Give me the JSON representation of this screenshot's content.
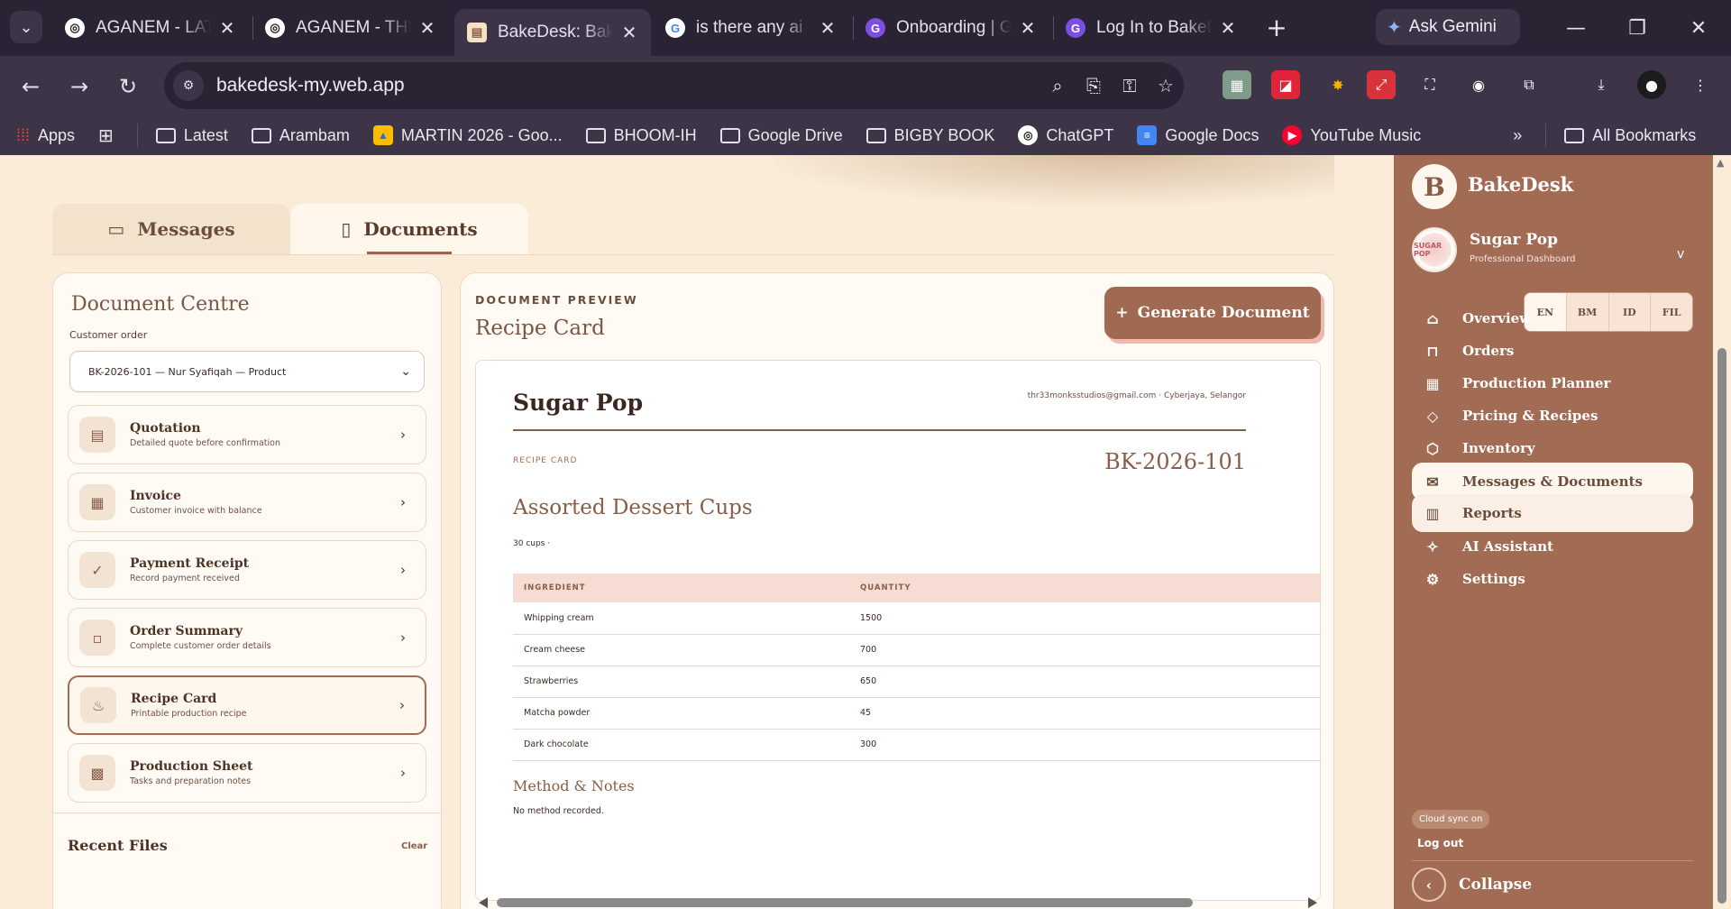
{
  "browser": {
    "tabs": [
      {
        "title": "AGANEM - LATEST",
        "icon": "chatgpt-icon"
      },
      {
        "title": "AGANEM - THE",
        "icon": "chatgpt-icon"
      },
      {
        "title": "BakeDesk: Bakery",
        "icon": "bakedesk-icon"
      },
      {
        "title": "is there any ai",
        "icon": "google-icon"
      },
      {
        "title": "Onboarding | G",
        "icon": "g-app-icon"
      },
      {
        "title": "Log In to BakeDesk",
        "icon": "g-app-icon"
      }
    ],
    "ask_gemini": "Ask Gemini",
    "url": "bakedesk-my.web.app",
    "bookmarks": [
      "Apps",
      "Latest",
      "Arambam",
      "MARTIN 2026 - Goo...",
      "BHOOM-IH",
      "Google Drive",
      "BIGBY BOOK",
      "ChatGPT",
      "Google Docs",
      "YouTube Music"
    ],
    "all_bookmarks": "All Bookmarks",
    "overflow": "»"
  },
  "tabs": {
    "messages": "Messages",
    "documents": "Documents"
  },
  "doc_centre": {
    "title": "Document Centre",
    "customer_order_label": "Customer order",
    "selected_order": "BK-2026-101 — Nur Syafiqah — Product",
    "items": [
      {
        "name": "Quotation",
        "desc": "Detailed quote before confirmation",
        "icon": "quotation-icon"
      },
      {
        "name": "Invoice",
        "desc": "Customer invoice with balance",
        "icon": "invoice-icon"
      },
      {
        "name": "Payment Receipt",
        "desc": "Record payment received",
        "icon": "check-icon"
      },
      {
        "name": "Order Summary",
        "desc": "Complete customer order details",
        "icon": "order-summary-icon"
      },
      {
        "name": "Recipe Card",
        "desc": "Printable production recipe",
        "icon": "cake-icon"
      },
      {
        "name": "Production Sheet",
        "desc": "Tasks and preparation notes",
        "icon": "production-sheet-icon"
      }
    ],
    "selected_item": "Recipe Card",
    "recent_files": "Recent Files",
    "clear": "Clear"
  },
  "preview": {
    "kicker": "DOCUMENT PREVIEW",
    "title": "Recipe Card",
    "generate_button": "Generate Document",
    "generate_prefix": "+",
    "paper": {
      "brand": "Sugar Pop",
      "contact": "thr33monksstudios@gmail.com · Cyberjaya, Selangor",
      "kicker": "RECIPE CARD",
      "reference": "BK-2026-101",
      "product": "Assorted Dessert Cups",
      "yield": "30 cups ·",
      "table_headers": [
        "INGREDIENT",
        "QUANTITY"
      ],
      "ingredients": [
        {
          "name": "Whipping cream",
          "quantity": "1500"
        },
        {
          "name": "Cream cheese",
          "quantity": "700"
        },
        {
          "name": "Strawberries",
          "quantity": "650"
        },
        {
          "name": "Matcha powder",
          "quantity": "45"
        },
        {
          "name": "Dark chocolate",
          "quantity": "300"
        }
      ],
      "method_title": "Method & Notes",
      "method_text": "No method recorded."
    }
  },
  "sidebar": {
    "brand_letter": "B",
    "brand": "BakeDesk",
    "business_name": "Sugar Pop",
    "business_sub": "Professional Dashboard",
    "business_avatar_text": "SUGAR POP",
    "chevron": "v",
    "languages": [
      "EN",
      "BM",
      "ID",
      "FIL"
    ],
    "active_language": "EN",
    "nav": [
      {
        "label": "Overview",
        "icon": "home-icon"
      },
      {
        "label": "Orders",
        "icon": "bag-icon"
      },
      {
        "label": "Production Planner",
        "icon": "calendar-icon"
      },
      {
        "label": "Pricing & Recipes",
        "icon": "tag-icon"
      },
      {
        "label": "Inventory",
        "icon": "box-icon"
      },
      {
        "label": "Messages & Documents",
        "icon": "mail-icon"
      },
      {
        "label": "Reports",
        "icon": "chart-icon"
      },
      {
        "label": "AI Assistant",
        "icon": "sparkle-icon"
      },
      {
        "label": "Settings",
        "icon": "gear-icon"
      }
    ],
    "active_nav": "Messages & Documents",
    "cloud_sync": "Cloud sync on",
    "logout": "Log out",
    "collapse": "Collapse"
  },
  "colors": {
    "sidebar": "#a26b53",
    "page_bg": "#faecd8",
    "accent": "#a06a52",
    "table_header": "#f6dcd3"
  }
}
